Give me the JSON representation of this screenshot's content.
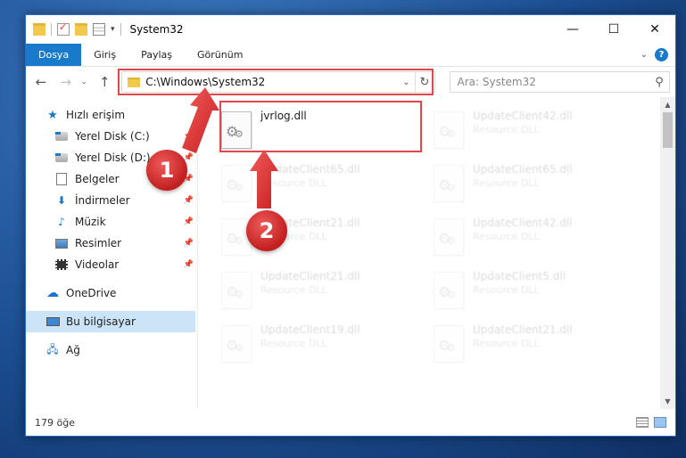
{
  "window": {
    "title": "System32",
    "controls": {
      "minimize": "—",
      "maximize": "☐",
      "close": "✕"
    }
  },
  "ribbon": {
    "tabs": [
      {
        "label": "Dosya",
        "active": true
      },
      {
        "label": "Giriş",
        "active": false
      },
      {
        "label": "Paylaş",
        "active": false
      },
      {
        "label": "Görünüm",
        "active": false
      }
    ],
    "help": "?"
  },
  "navbar": {
    "address": "C:\\Windows\\System32",
    "search_placeholder": "Ara: System32"
  },
  "sidebar": {
    "quick_access": "Hızlı erişim",
    "items": [
      {
        "label": "Yerel Disk (C:)",
        "icon": "drive-icon",
        "pinned": true
      },
      {
        "label": "Yerel Disk (D:)",
        "icon": "drive-icon",
        "pinned": true
      },
      {
        "label": "Belgeler",
        "icon": "documents-icon",
        "pinned": true
      },
      {
        "label": "İndirmeler",
        "icon": "download-icon",
        "pinned": true
      },
      {
        "label": "Müzik",
        "icon": "music-icon",
        "pinned": true
      },
      {
        "label": "Resimler",
        "icon": "pictures-icon",
        "pinned": true
      },
      {
        "label": "Videolar",
        "icon": "videos-icon",
        "pinned": true
      }
    ],
    "onedrive": "OneDrive",
    "this_pc": "Bu bilgisayar",
    "network": "Ağ"
  },
  "files": [
    {
      "name": "jvrlog.dll",
      "type": "",
      "highlighted": true
    },
    {
      "name": "UpdateClient42.dll",
      "type": "Resource DLL"
    },
    {
      "name": "UpdateClient65.dll",
      "type": "Resource DLL"
    },
    {
      "name": "UpdateClient65.dll",
      "type": "Resource DLL"
    },
    {
      "name": "UpdateClient21.dll",
      "type": "Resource DLL"
    },
    {
      "name": "UpdateClient42.dll",
      "type": "Resource DLL"
    },
    {
      "name": "UpdateClient21.dll",
      "type": "Resource DLL"
    },
    {
      "name": "UpdateClient5.dll",
      "type": "Resource DLL"
    },
    {
      "name": "UpdateClient19.dll",
      "type": "Resource DLL"
    },
    {
      "name": "UpdateClient21.dll",
      "type": "Resource DLL"
    }
  ],
  "status": {
    "item_count": "179 öğe"
  },
  "annotations": {
    "step1": "1",
    "step2": "2",
    "color": "#e0464b"
  }
}
